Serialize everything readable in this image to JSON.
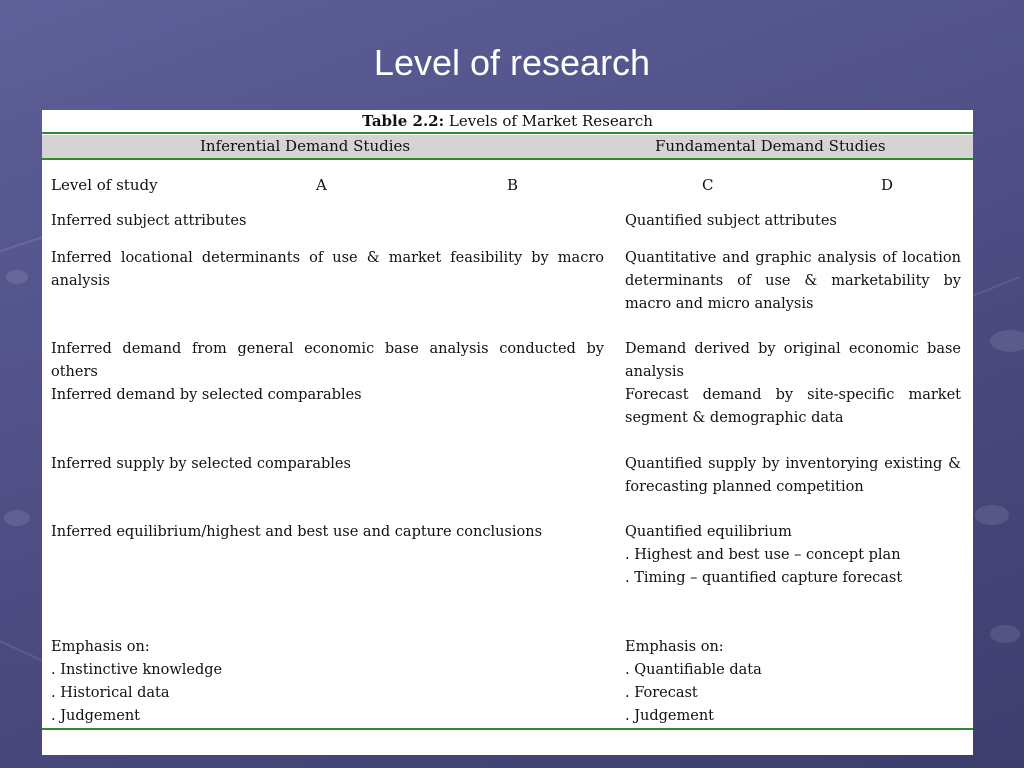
{
  "slide": {
    "title": "Level of research"
  },
  "table": {
    "caption_label": "Table 2.2:",
    "caption_text": "Levels of Market Research",
    "header_left": "Inferential Demand Studies",
    "header_right": "Fundamental Demand Studies",
    "level_row": {
      "label": "Level of study",
      "a": "A",
      "b": "B",
      "c": "C",
      "d": "D"
    },
    "rows": [
      {
        "left": [
          "Inferred subject attributes"
        ],
        "right": [
          "Quantified subject attributes"
        ]
      },
      {
        "left": [
          "Inferred locational determinants of use & market feasibility by macro analysis"
        ],
        "right": [
          "Quantitative and graphic analysis of location determinants of use & marketability by macro and micro analysis"
        ]
      },
      {
        "left": [
          "Inferred demand from general economic base analysis conducted by others"
        ],
        "right": [
          "Demand derived by original economic base analysis"
        ]
      },
      {
        "left": [
          "Inferred demand by selected comparables"
        ],
        "right": [
          "Forecast demand by site-specific market segment & demographic data"
        ]
      },
      {
        "left": [
          "Inferred supply by selected comparables"
        ],
        "right": [
          "Quantified supply by inventorying existing & forecasting planned competition"
        ]
      },
      {
        "left": [
          "Inferred equilibrium/highest and best use and capture conclusions"
        ],
        "right": [
          "Quantified equilibrium",
          ". Highest and best use – concept plan",
          ". Timing – quantified capture forecast"
        ]
      },
      {
        "left": [
          "Emphasis on:",
          ". Instinctive knowledge",
          ". Historical data",
          ". Judgement"
        ],
        "right": [
          "Emphasis on:",
          ". Quantifiable data",
          ". Forecast",
          ". Judgement"
        ]
      }
    ]
  }
}
